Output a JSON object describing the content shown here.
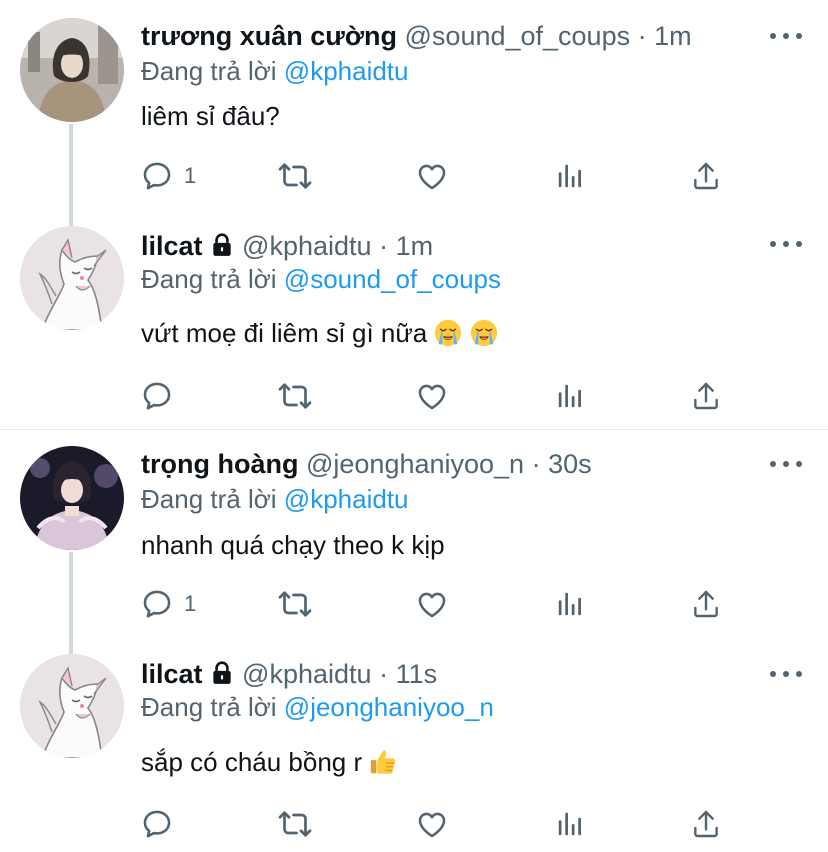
{
  "tweets": [
    {
      "name": "trương xuân cường",
      "handle": "@sound_of_coups",
      "time": "1m",
      "locked": false,
      "replying_label": "Đang trả lời",
      "replying_to": "@kphaidtu",
      "text": "liêm sỉ đâu?",
      "reply_count": "1",
      "avatar": "photo-person-hood"
    },
    {
      "name": "lilcat",
      "handle": "@kphaidtu",
      "time": "1m",
      "locked": true,
      "replying_label": "Đang trả lời",
      "replying_to": "@sound_of_coups",
      "text": "vứt moẹ đi liêm sỉ gì nữa",
      "emoji": [
        "loudly-crying-face-emoji",
        "loudly-crying-face-emoji"
      ],
      "reply_count": "",
      "avatar": "cat-drawing"
    },
    {
      "name": "trọng hoàng",
      "handle": "@jeonghaniyoo_n",
      "time": "30s",
      "locked": false,
      "replying_label": "Đang trả lời",
      "replying_to": "@kphaidtu",
      "text": "nhanh quá chạy theo k kịp",
      "reply_count": "1",
      "avatar": "photo-person-stage"
    },
    {
      "name": "lilcat",
      "handle": "@kphaidtu",
      "time": "11s",
      "locked": true,
      "replying_label": "Đang trả lời",
      "replying_to": "@jeonghaniyoo_n",
      "text": "sắp có cháu bồng r",
      "emoji": [
        "thumbs-up-emoji"
      ],
      "reply_count": "",
      "avatar": "cat-drawing"
    }
  ],
  "separator": "·",
  "colors": {
    "text": "#0f1419",
    "secondary": "#536471",
    "link": "#1d9bf0",
    "thread_line": "#cfd9de",
    "divider": "#e6ecf0"
  },
  "icons": [
    "reply-icon",
    "retweet-icon",
    "like-icon",
    "analytics-icon",
    "share-icon",
    "more-icon",
    "lock-icon"
  ]
}
